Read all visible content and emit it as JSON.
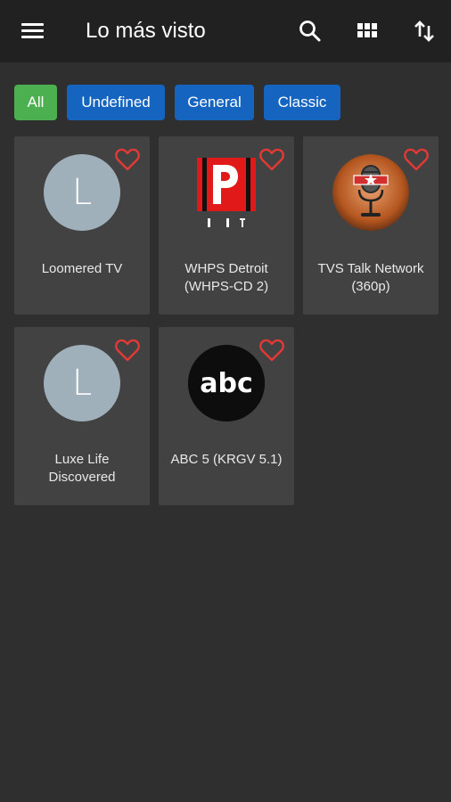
{
  "appbar": {
    "title": "Lo más visto",
    "menu_icon": "hamburger-menu-icon",
    "search_icon": "search-icon",
    "grid_icon": "grid-view-icon",
    "sort_icon": "sort-icon"
  },
  "filters": [
    {
      "label": "All",
      "color": "#4caf50",
      "selected": true
    },
    {
      "label": "Undefined",
      "color": "#1565c0",
      "selected": false
    },
    {
      "label": "General",
      "color": "#1565c0",
      "selected": false
    },
    {
      "label": "Classic",
      "color": "#1565c0",
      "selected": false
    }
  ],
  "channels": [
    {
      "name": "Loomered TV",
      "logo": "letter-avatar",
      "letter": "L",
      "favorite_icon": "heart-outline-icon"
    },
    {
      "name": "WHPS Detroit (WHPS-CD 2)",
      "logo": "whps-logo",
      "favorite_icon": "heart-outline-icon"
    },
    {
      "name": "TVS Talk Network (360p)",
      "logo": "tvs-microphone-logo",
      "favorite_icon": "heart-outline-icon"
    },
    {
      "name": "Luxe Life Discovered",
      "logo": "letter-avatar",
      "letter": "L",
      "favorite_icon": "heart-outline-icon"
    },
    {
      "name": "ABC 5 (KRGV 5.1)",
      "logo": "abc-logo",
      "logo_text": "abc",
      "favorite_icon": "heart-outline-icon"
    }
  ],
  "colors": {
    "background": "#2f2f2f",
    "appbar": "#212121",
    "card": "#424242",
    "favorite": "#e53935"
  }
}
